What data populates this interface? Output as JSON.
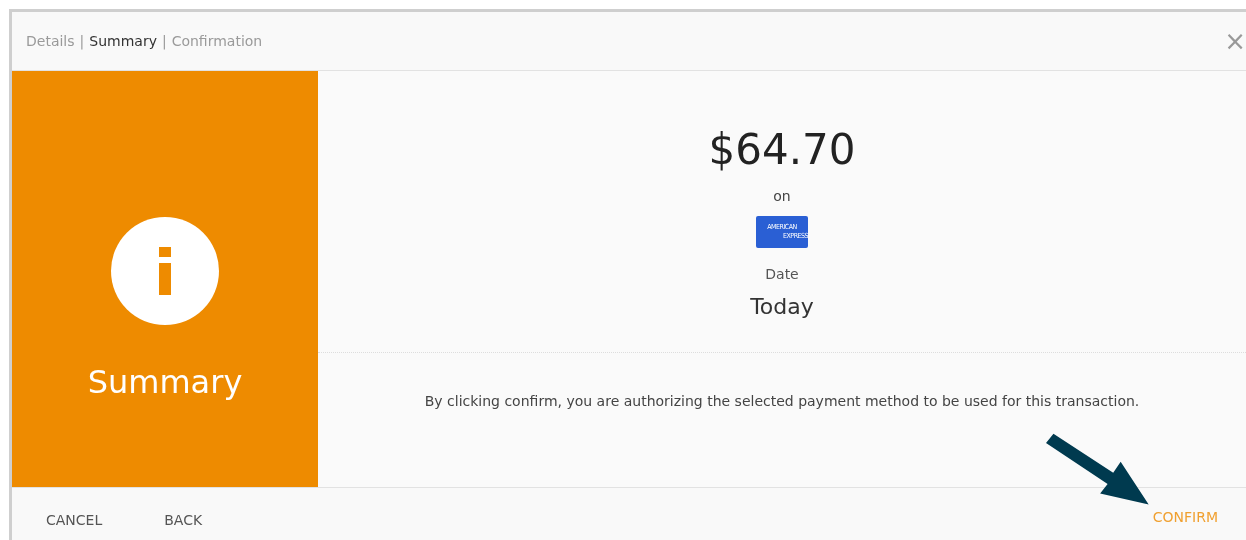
{
  "breadcrumb": {
    "separator": "|",
    "steps": [
      {
        "label": "Details",
        "selected": false
      },
      {
        "label": "Summary",
        "selected": true
      },
      {
        "label": "Confirmation",
        "selected": false
      }
    ]
  },
  "close": "×",
  "side_panel": {
    "title": "Summary"
  },
  "amount": "$64.70",
  "on_label": "on",
  "card": {
    "logo_lines": [
      "AMERICAN",
      "EXPRESS"
    ]
  },
  "date_label": "Date",
  "date_value": "Today",
  "notice": "By clicking confirm, you are authorizing the selected payment method to be used for this transaction.",
  "buttons": [
    {
      "label": "CANCEL",
      "kind": "plain"
    },
    {
      "label": "BACK",
      "kind": "plain"
    },
    {
      "label": "CONFIRM",
      "kind": "primary"
    }
  ],
  "annotation": {
    "kind": "arrow"
  }
}
